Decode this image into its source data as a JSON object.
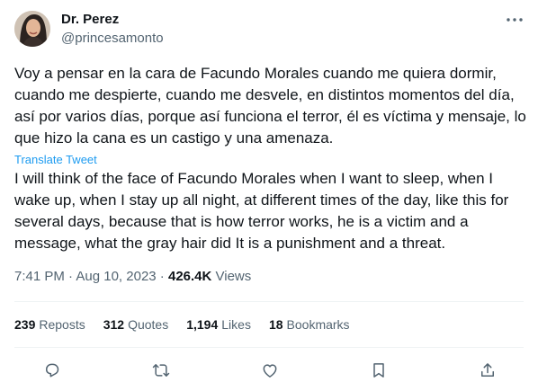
{
  "author": {
    "display_name": "Dr. Perez",
    "handle": "@princesamonto"
  },
  "tweet": {
    "text_original": "Voy a pensar en la cara de Facundo Morales cuando me quiera dormir, cuando me despierte, cuando me desvele, en distintos momentos del día, así por varios días, porque así funciona el terror, él es víctima y mensaje, lo que hizo la cana es un castigo y una amenaza.",
    "translate_label": "Translate Tweet",
    "text_translated": "I will think of the face of Facundo Morales when I want to sleep, when I wake up, when I stay up all night, at different times of the day, like this for several days, because that is how terror works, he is a victim and a message, what the gray hair did It is a punishment and a threat."
  },
  "meta": {
    "time": "7:41 PM",
    "separator": " · ",
    "date": "Aug 10, 2023",
    "views_count": "426.4K",
    "views_label": " Views"
  },
  "stats": [
    {
      "count": "239",
      "label": "Reposts"
    },
    {
      "count": "312",
      "label": "Quotes"
    },
    {
      "count": "1,194",
      "label": "Likes"
    },
    {
      "count": "18",
      "label": "Bookmarks"
    }
  ],
  "actions": [
    {
      "icon": "reply-icon"
    },
    {
      "icon": "repost-icon"
    },
    {
      "icon": "like-icon"
    },
    {
      "icon": "bookmark-icon"
    },
    {
      "icon": "share-icon"
    }
  ],
  "colors": {
    "link": "#1d9bf0",
    "secondary_text": "#536471",
    "primary_text": "#0f1419",
    "divider": "#eff3f4"
  }
}
